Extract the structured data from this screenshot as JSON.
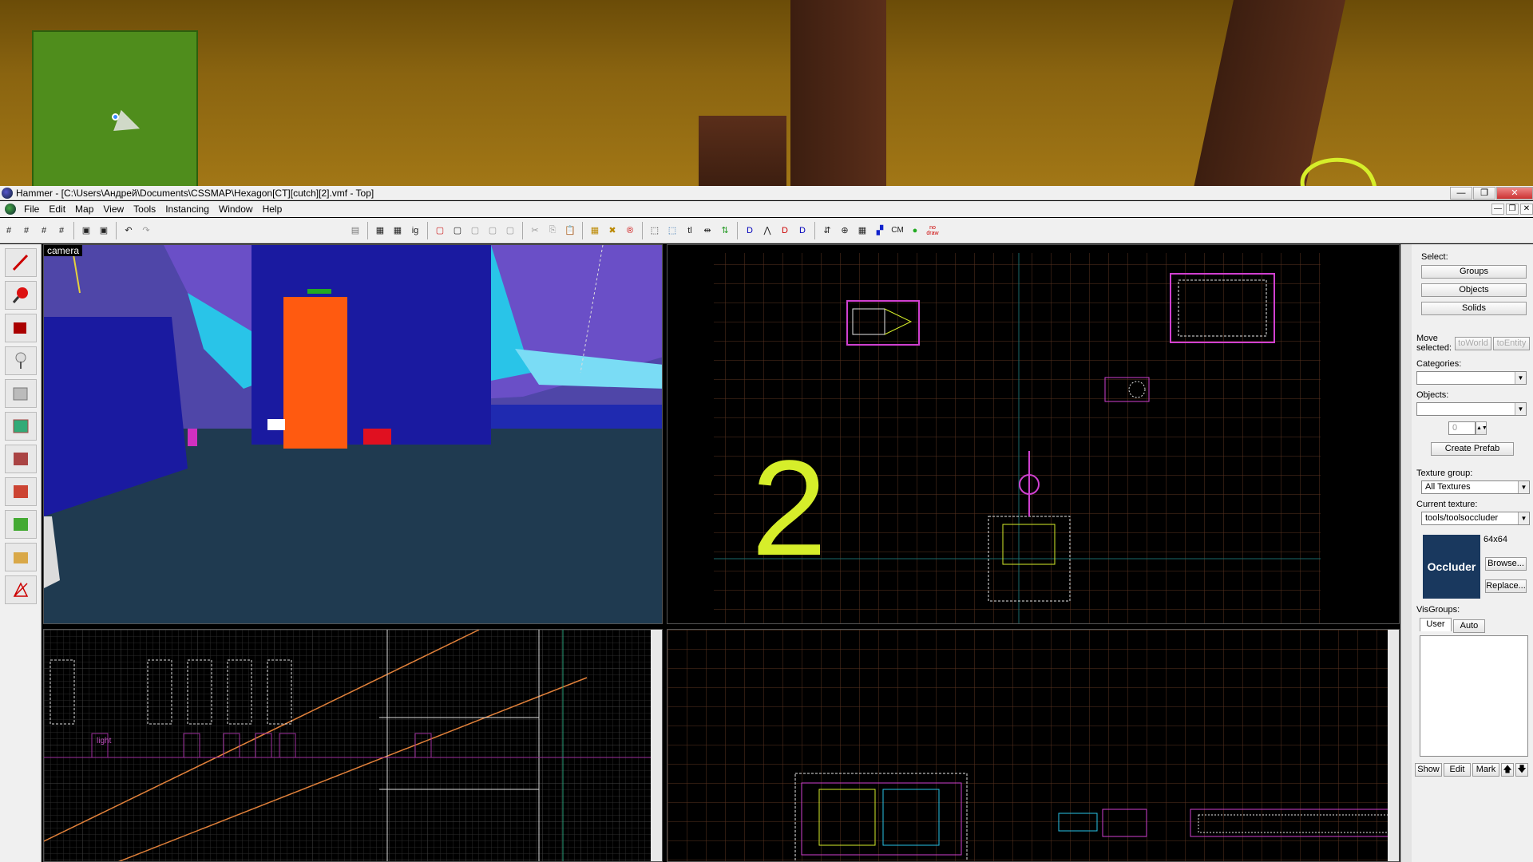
{
  "window": {
    "title": "Hammer - [C:\\Users\\Андрей\\Documents\\CSSMAP\\Hexagon[CT][cutch][2].vmf - Top]",
    "minimize": "—",
    "maximize": "❐",
    "close": "✕"
  },
  "menu": {
    "items": [
      "File",
      "Edit",
      "Map",
      "View",
      "Tools",
      "Instancing",
      "Window",
      "Help"
    ],
    "mdi_min": "—",
    "mdi_max": "❐",
    "mdi_close": "✕"
  },
  "toolbar": {
    "cm_label": "CM",
    "nodraw_label": "no draw"
  },
  "viewports": {
    "camera_label": "camera",
    "side_entity_label": "light"
  },
  "annotation": {
    "number": "2",
    "color": "#d6ee2a"
  },
  "right_panel": {
    "select_label": "Select:",
    "groups": "Groups",
    "objects": "Objects",
    "solids": "Solids",
    "move_selected": "Move selected:",
    "to_world": "toWorld",
    "to_entity": "toEntity",
    "categories_label": "Categories:",
    "objects_label": "Objects:",
    "objects_count": "0",
    "create_prefab": "Create Prefab",
    "texture_group_label": "Texture group:",
    "texture_group_value": "All Textures",
    "current_texture_label": "Current texture:",
    "current_texture_value": "tools/toolsoccluder",
    "texture_size": "64x64",
    "texture_preview": "Occluder",
    "browse": "Browse...",
    "replace": "Replace...",
    "visgroups_label": "VisGroups:",
    "tab_user": "User",
    "tab_auto": "Auto",
    "show": "Show",
    "edit": "Edit",
    "mark": "Mark",
    "up": "🡅",
    "down": "🡇"
  },
  "colors": {
    "grid_fine": "#3a3a3a",
    "grid_major": "#6a3a1e",
    "selection": "#d040d0",
    "brush_white": "#e6e6e6",
    "camera_wall": "#1a1aa0",
    "camera_door": "#ff5a10"
  }
}
